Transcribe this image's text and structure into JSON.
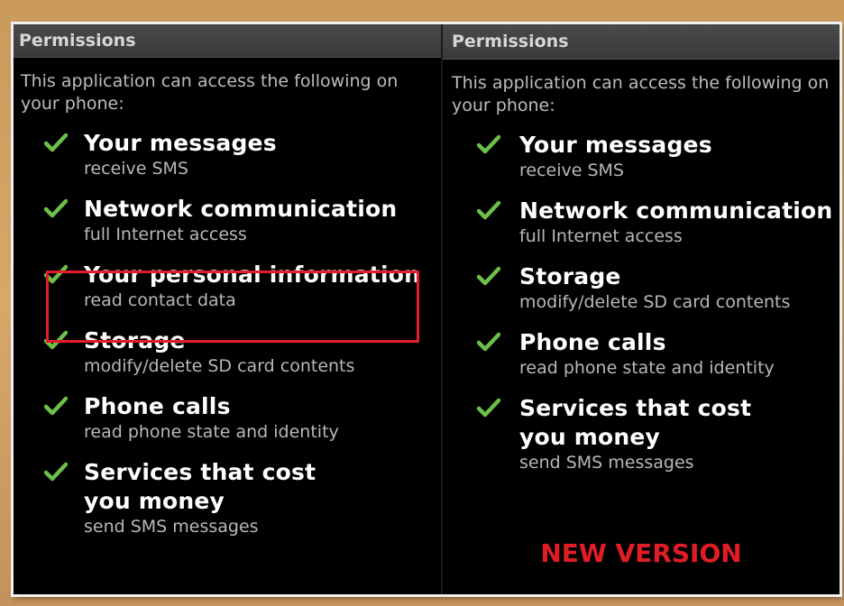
{
  "left_panel": {
    "header": "Permissions",
    "intro": "This application can access the following on your phone:",
    "items": [
      {
        "title": "Your messages",
        "sub": "receive SMS"
      },
      {
        "title": "Network communication",
        "sub": "full Internet access"
      },
      {
        "title": "Your personal information",
        "sub": "read contact data"
      },
      {
        "title": "Storage",
        "sub": "modify/delete SD card contents"
      },
      {
        "title": "Phone calls",
        "sub": "read phone state and identity"
      },
      {
        "title": "Services that cost you money",
        "sub": "send SMS messages"
      }
    ]
  },
  "right_panel": {
    "header": "Permissions",
    "intro": "This application can access the following on your phone:",
    "items": [
      {
        "title": "Your messages",
        "sub": "receive SMS"
      },
      {
        "title": "Network communication",
        "sub": "full Internet access"
      },
      {
        "title": "Storage",
        "sub": "modify/delete SD card contents"
      },
      {
        "title": "Phone calls",
        "sub": "read phone state and identity"
      },
      {
        "title": "Services that cost you money",
        "sub": "send SMS messages"
      }
    ],
    "caption": "NEW VERSION"
  },
  "colors": {
    "check": "#6cc04a",
    "highlight": "#e21c2a",
    "caption": "#e01d24"
  },
  "icons": {
    "check": "check-icon"
  }
}
